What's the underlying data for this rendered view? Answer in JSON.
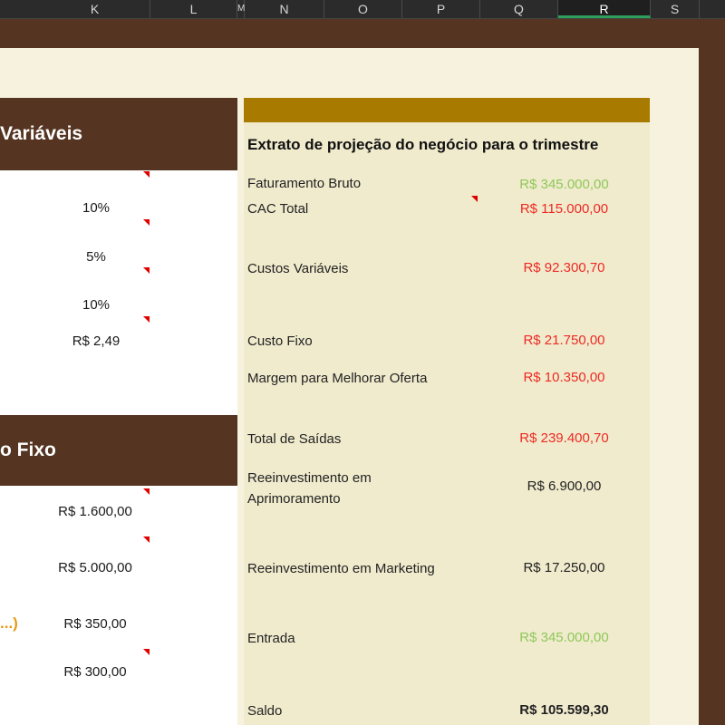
{
  "columns": [
    "K",
    "L",
    "M",
    "N",
    "O",
    "P",
    "Q",
    "R",
    "S"
  ],
  "left": {
    "section1_title": "Variáveis",
    "section1_values": [
      "10%",
      "5%",
      "10%",
      "R$ 2,49"
    ],
    "section2_title": "o Fixo",
    "section2_values": [
      "R$ 1.600,00",
      "R$ 5.000,00",
      "R$ 350,00",
      "R$ 300,00"
    ],
    "truncated_text": "...)"
  },
  "right": {
    "title": "Extrato de projeção do negócio para o trimestre",
    "rows": [
      {
        "label": "Faturamento Bruto",
        "value": "R$ 345.000,00"
      },
      {
        "label": "CAC Total",
        "value": "R$ 115.000,00"
      },
      {
        "label": "Custos Variáveis",
        "value": "R$ 92.300,70"
      },
      {
        "label": "Custo Fixo",
        "value": "R$ 21.750,00"
      },
      {
        "label": "Margem para Melhorar Oferta",
        "value": "R$ 10.350,00"
      },
      {
        "label": "Total de Saídas",
        "value": "R$ 239.400,70"
      },
      {
        "label": "Reeinvestimento em Aprimoramento",
        "value": "R$ 6.900,00"
      },
      {
        "label": "Reeinvestimento em Marketing",
        "value": "R$ 17.250,00"
      },
      {
        "label": "Entrada",
        "value": "R$ 345.000,00"
      },
      {
        "label": "Saldo",
        "value": "R$ 105.599,30"
      }
    ]
  },
  "colors": {
    "positive": "#8fc85a",
    "negative": "#ee2a24",
    "header_brown": "#553421",
    "accent_gold": "#a87a00"
  }
}
